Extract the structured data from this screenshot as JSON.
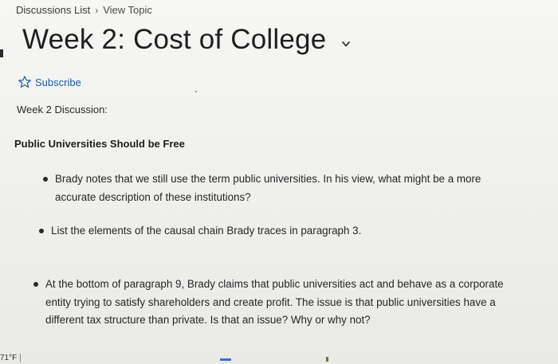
{
  "breadcrumb": {
    "discussions_list": "Discussions List",
    "separator": "›",
    "view_topic": "View Topic"
  },
  "topic": {
    "title": "Week 2: Cost of College",
    "chevron_icon": "chevron-down-icon"
  },
  "subscribe": {
    "label": "Subscribe",
    "icon": "star-outline-icon"
  },
  "content": {
    "discussion_heading": "Week 2 Discussion:",
    "section_title": "Public Universities Should be Free",
    "bullets": [
      "Brady notes that we still use the term public universities. In his view, what might be a more accurate description of these institutions?",
      "List the elements of the causal chain Brady traces in paragraph 3.",
      "At the bottom of paragraph 9, Brady claims that public universities act and behave as a corporate entity trying to satisfy shareholders and create profit. The issue is that public universities have a different tax structure than private. Is that an issue? Why or why not?"
    ]
  },
  "taskbar": {
    "temperature": "71°F"
  },
  "colors": {
    "link": "#1d5fa8",
    "text": "#262626",
    "background": "#f3f3f1"
  }
}
